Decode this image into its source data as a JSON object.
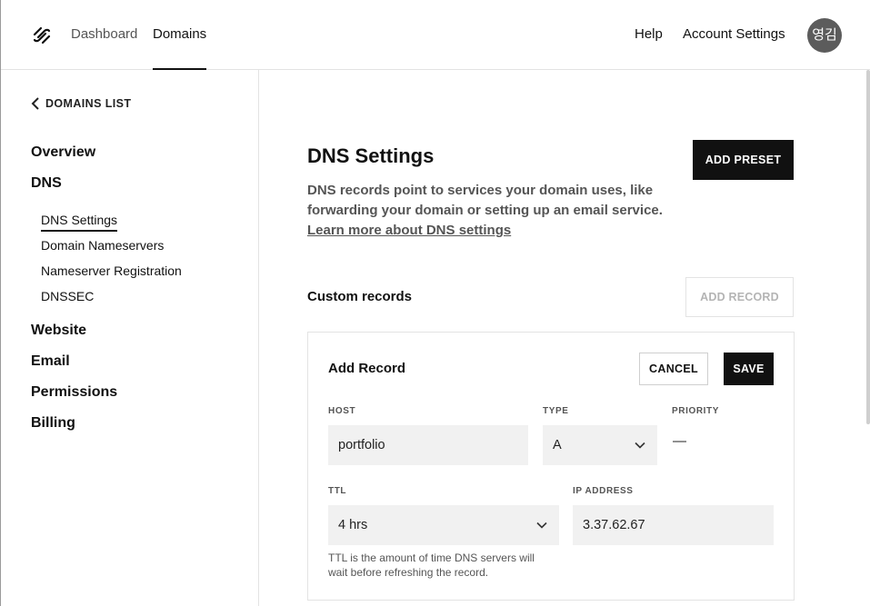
{
  "topnav": {
    "logo": "squarespace-logo",
    "dashboard": "Dashboard",
    "domains": "Domains",
    "help": "Help",
    "account_settings": "Account Settings",
    "avatar_initials": "영김"
  },
  "sidebar": {
    "back_label": "DOMAINS LIST",
    "overview": "Overview",
    "dns": "DNS",
    "dns_items": [
      "DNS Settings",
      "Domain Nameservers",
      "Nameserver Registration",
      "DNSSEC"
    ],
    "website": "Website",
    "email": "Email",
    "permissions": "Permissions",
    "billing": "Billing"
  },
  "main": {
    "title": "DNS Settings",
    "add_preset": "ADD PRESET",
    "description": "DNS records point to services your domain uses, like forwarding your domain or setting up an email service.",
    "learn_more": "Learn more about DNS settings",
    "custom_records": "Custom records",
    "add_record": "ADD RECORD"
  },
  "add_record_card": {
    "title": "Add Record",
    "cancel": "CANCEL",
    "save": "SAVE",
    "host_label": "HOST",
    "host_value": "portfolio",
    "type_label": "TYPE",
    "type_value": "A",
    "priority_label": "PRIORITY",
    "priority_value": "—",
    "ttl_label": "TTL",
    "ttl_value": "4 hrs",
    "ip_label": "IP ADDRESS",
    "ip_value": "3.37.62.67",
    "ttl_help": "TTL is the amount of time DNS servers will wait before refreshing the record."
  }
}
